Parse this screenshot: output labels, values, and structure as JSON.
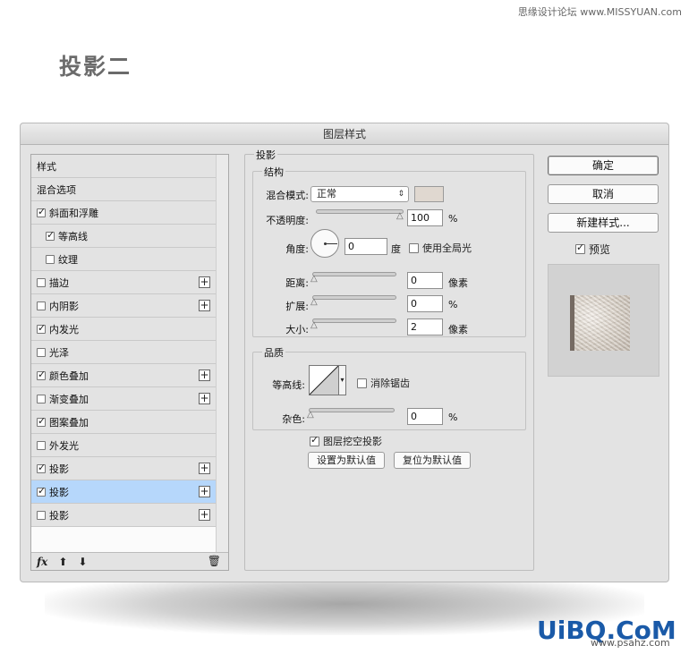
{
  "watermark_top": "思缘设计论坛 www.MISSYUAN.com",
  "page_title": "投影二",
  "dialog": {
    "title": "图层样式",
    "style_list": {
      "items": [
        {
          "label": "样式",
          "checkbox": false,
          "checked": false,
          "plus": false,
          "indent": false,
          "selected": false
        },
        {
          "label": "混合选项",
          "checkbox": false,
          "checked": false,
          "plus": false,
          "indent": false,
          "selected": false
        },
        {
          "label": "斜面和浮雕",
          "checkbox": true,
          "checked": true,
          "plus": false,
          "indent": false,
          "selected": false
        },
        {
          "label": "等高线",
          "checkbox": true,
          "checked": true,
          "plus": false,
          "indent": true,
          "selected": false
        },
        {
          "label": "纹理",
          "checkbox": true,
          "checked": false,
          "plus": false,
          "indent": true,
          "selected": false
        },
        {
          "label": "描边",
          "checkbox": true,
          "checked": false,
          "plus": true,
          "indent": false,
          "selected": false
        },
        {
          "label": "内阴影",
          "checkbox": true,
          "checked": false,
          "plus": true,
          "indent": false,
          "selected": false
        },
        {
          "label": "内发光",
          "checkbox": true,
          "checked": true,
          "plus": false,
          "indent": false,
          "selected": false
        },
        {
          "label": "光泽",
          "checkbox": true,
          "checked": false,
          "plus": false,
          "indent": false,
          "selected": false
        },
        {
          "label": "颜色叠加",
          "checkbox": true,
          "checked": true,
          "plus": true,
          "indent": false,
          "selected": false
        },
        {
          "label": "渐变叠加",
          "checkbox": true,
          "checked": false,
          "plus": true,
          "indent": false,
          "selected": false
        },
        {
          "label": "图案叠加",
          "checkbox": true,
          "checked": true,
          "plus": false,
          "indent": false,
          "selected": false
        },
        {
          "label": "外发光",
          "checkbox": true,
          "checked": false,
          "plus": false,
          "indent": false,
          "selected": false
        },
        {
          "label": "投影",
          "checkbox": true,
          "checked": true,
          "plus": true,
          "indent": false,
          "selected": false
        },
        {
          "label": "投影",
          "checkbox": true,
          "checked": true,
          "plus": true,
          "indent": false,
          "selected": true
        },
        {
          "label": "投影",
          "checkbox": true,
          "checked": false,
          "plus": true,
          "indent": false,
          "selected": false
        }
      ],
      "bottom": {
        "fx_label": "fx",
        "up_icon": "arrow-up-icon",
        "down_icon": "arrow-down-icon",
        "trash_icon": "trash-icon"
      }
    },
    "drop_shadow": {
      "section_title": "投影",
      "structure_title": "结构",
      "blend_mode_label": "混合模式:",
      "blend_mode_value": "正常",
      "shadow_color": "#e0d8d0",
      "opacity_label": "不透明度:",
      "opacity_value": "100",
      "opacity_unit": "%",
      "angle_label": "角度:",
      "angle_value": "0",
      "angle_unit": "度",
      "global_light_label": "使用全局光",
      "global_light_checked": false,
      "distance_label": "距离:",
      "distance_value": "0",
      "distance_unit": "像素",
      "spread_label": "扩展:",
      "spread_value": "0",
      "spread_unit": "%",
      "size_label": "大小:",
      "size_value": "2",
      "size_unit": "像素",
      "quality_title": "品质",
      "contour_label": "等高线:",
      "anti_alias_label": "消除锯齿",
      "anti_alias_checked": false,
      "noise_label": "杂色:",
      "noise_value": "0",
      "noise_unit": "%",
      "knockout_label": "图层挖空投影",
      "knockout_checked": true,
      "set_default_label": "设置为默认值",
      "reset_default_label": "复位为默认值"
    },
    "buttons": {
      "ok": "确定",
      "cancel": "取消",
      "new_style": "新建样式...",
      "preview_label": "预览",
      "preview_checked": true
    }
  },
  "logo": {
    "text": "UiBQ.CoM",
    "sub": "www.psahz.com"
  }
}
